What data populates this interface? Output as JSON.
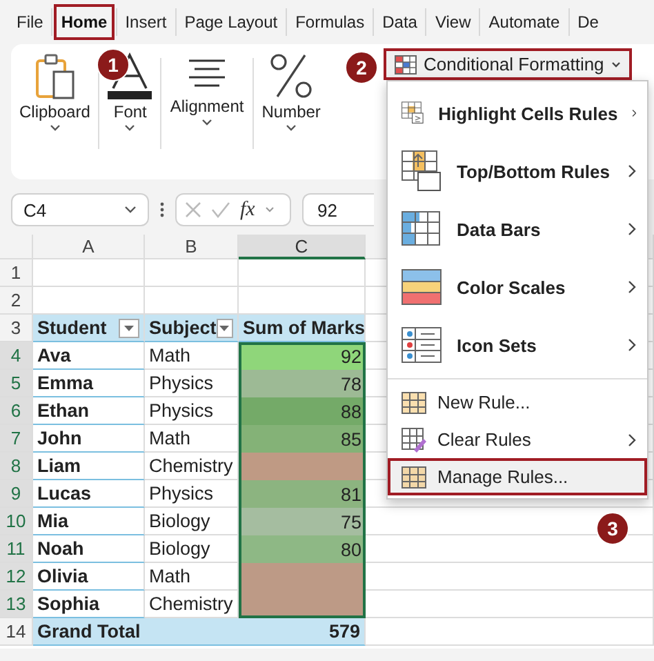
{
  "tabs": [
    {
      "label": "File",
      "selected": false,
      "highlighted": false
    },
    {
      "label": "Home",
      "selected": true,
      "highlighted": true,
      "badge": "1"
    },
    {
      "label": "Insert",
      "selected": false,
      "highlighted": false
    },
    {
      "label": "Page Layout",
      "selected": false,
      "highlighted": false
    },
    {
      "label": "Formulas",
      "selected": false,
      "highlighted": false
    },
    {
      "label": "Data",
      "selected": false,
      "highlighted": false
    },
    {
      "label": "View",
      "selected": false,
      "highlighted": false
    },
    {
      "label": "Automate",
      "selected": false,
      "highlighted": false
    },
    {
      "label": "De",
      "selected": false,
      "highlighted": false
    }
  ],
  "ribbon": {
    "groups": [
      {
        "label": "Clipboard"
      },
      {
        "label": "Font"
      },
      {
        "label": "Alignment"
      },
      {
        "label": "Number"
      }
    ],
    "cf_button": {
      "label": "Conditional Formatting",
      "highlighted": true,
      "badge": "2"
    }
  },
  "formula_bar": {
    "name_box": "C4",
    "fx": "fx",
    "formula": "92"
  },
  "sheet": {
    "columns": [
      {
        "label": "A",
        "selected": false
      },
      {
        "label": "B",
        "selected": false
      },
      {
        "label": "C",
        "selected": true
      }
    ],
    "rows": [
      {
        "number": "1",
        "kind": "empty",
        "selected": false
      },
      {
        "number": "2",
        "kind": "empty",
        "selected": false
      },
      {
        "number": "3",
        "kind": "header",
        "selected": false,
        "cells": [
          {
            "text": "Student",
            "filter": true
          },
          {
            "text": "Subject",
            "filter": true
          },
          {
            "text": "Sum of Marks",
            "filter": false
          }
        ]
      },
      {
        "number": "4",
        "kind": "data",
        "selected": true,
        "student": "Ava",
        "subject": "Math",
        "marks": "92",
        "color": "#8fd67a"
      },
      {
        "number": "5",
        "kind": "data",
        "selected": true,
        "student": "Emma",
        "subject": "Physics",
        "marks": "78",
        "color": "#9dba95"
      },
      {
        "number": "6",
        "kind": "data",
        "selected": true,
        "student": "Ethan",
        "subject": "Physics",
        "marks": "88",
        "color": "#74aa68"
      },
      {
        "number": "7",
        "kind": "data",
        "selected": true,
        "student": "John",
        "subject": "Math",
        "marks": "85",
        "color": "#84b277"
      },
      {
        "number": "8",
        "kind": "data",
        "selected": true,
        "student": "Liam",
        "subject": "Chemistry",
        "color": "#bf9a84"
      },
      {
        "number": "9",
        "kind": "data",
        "selected": true,
        "student": "Lucas",
        "subject": "Physics",
        "marks": "81",
        "color": "#8cb480"
      },
      {
        "number": "10",
        "kind": "data",
        "selected": true,
        "student": "Mia",
        "subject": "Biology",
        "marks": "75",
        "color": "#a5bda0"
      },
      {
        "number": "11",
        "kind": "data",
        "selected": true,
        "student": "Noah",
        "subject": "Biology",
        "marks": "80",
        "color": "#8eb885"
      },
      {
        "number": "12",
        "kind": "data",
        "selected": true,
        "student": "Olivia",
        "subject": "Math",
        "color": "#bd9a86"
      },
      {
        "number": "13",
        "kind": "data",
        "selected": true,
        "student": "Sophia",
        "subject": "Chemistry",
        "color": "#bd9a86"
      },
      {
        "number": "14",
        "kind": "total",
        "selected": false,
        "label": "Grand Total",
        "total": "579"
      }
    ]
  },
  "cf_menu": {
    "items": [
      {
        "kind": "large",
        "label": "Highlight Cells Rules",
        "submenu": true,
        "highlighted": false
      },
      {
        "kind": "large",
        "label": "Top/Bottom Rules",
        "submenu": true,
        "highlighted": false
      },
      {
        "kind": "large",
        "label": "Data Bars",
        "submenu": true,
        "highlighted": false
      },
      {
        "kind": "large",
        "label": "Color Scales",
        "submenu": true,
        "highlighted": false
      },
      {
        "kind": "large",
        "label": "Icon Sets",
        "submenu": true,
        "highlighted": false
      },
      {
        "kind": "small",
        "label": "New Rule...",
        "submenu": false,
        "highlighted": false
      },
      {
        "kind": "small",
        "label": "Clear Rules",
        "submenu": true,
        "highlighted": false
      },
      {
        "kind": "small",
        "label": "Manage Rules...",
        "submenu": false,
        "highlighted": true,
        "badge": "3"
      }
    ]
  }
}
